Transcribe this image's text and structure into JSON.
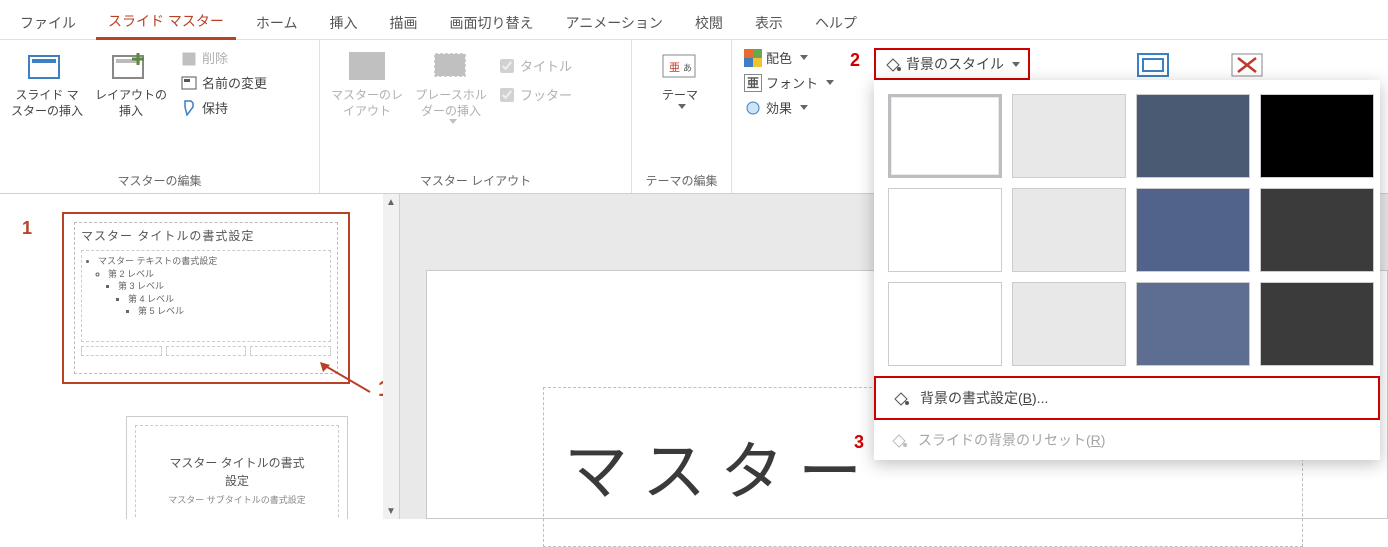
{
  "tabs": {
    "file": "ファイル",
    "slide_master": "スライド マスター",
    "home": "ホーム",
    "insert": "挿入",
    "draw": "描画",
    "transitions": "画面切り替え",
    "animations": "アニメーション",
    "review": "校閲",
    "view": "表示",
    "help": "ヘルプ"
  },
  "ribbon": {
    "group1": {
      "label": "マスターの編集",
      "insert_master": "スライド マスターの挿入",
      "insert_layout": "レイアウトの挿入",
      "delete": "削除",
      "rename": "名前の変更",
      "preserve": "保持"
    },
    "group2": {
      "label": "マスター レイアウト",
      "master_layout": "マスターのレイアウト",
      "insert_placeholder": "プレースホルダーの挿入",
      "title_chk": "タイトル",
      "footer_chk": "フッター"
    },
    "group3": {
      "label": "テーマの編集",
      "themes": "テーマ"
    },
    "group4": {
      "colors": "配色",
      "fonts": "フォント",
      "effects": "効果"
    },
    "bg_styles": "背景のスタイル"
  },
  "bg_panel": {
    "swatches": [
      {
        "bg": "#ffffff",
        "selected": true
      },
      {
        "bg": "#e8e8e8",
        "selected": false
      },
      {
        "bg": "#4a5a73",
        "selected": false
      },
      {
        "bg": "#000000",
        "selected": false
      },
      {
        "bg": "#ffffff",
        "selected": false
      },
      {
        "bg": "#e8e8e8",
        "selected": false
      },
      {
        "bg": "#51638a",
        "selected": false
      },
      {
        "bg": "#3b3b3b",
        "selected": false
      },
      {
        "bg": "#ffffff",
        "selected": false
      },
      {
        "bg": "#e8e8e8",
        "selected": false
      },
      {
        "bg": "#5d6e92",
        "selected": false
      },
      {
        "bg": "#3b3b3b",
        "selected": false
      }
    ],
    "format_bg": "背景の書式設定(",
    "format_bg_key": "B",
    "format_bg_suffix": ")...",
    "reset_bg": "スライドの背景のリセット(",
    "reset_bg_key": "R",
    "reset_bg_suffix": ")"
  },
  "thumb": {
    "master_title": "マスター タイトルの書式設定",
    "master_text": "マスター テキストの書式設定",
    "lvl2": "第 2 レベル",
    "lvl3": "第 3 レベル",
    "lvl4": "第 4 レベル",
    "lvl5": "第 5 レベル",
    "layout_title_l1": "マスター タイトルの書式",
    "layout_title_l2": "設定",
    "layout_sub": "マスター サブタイトルの書式設定"
  },
  "slide": {
    "title_text": "マスター"
  },
  "annot": {
    "one": "1",
    "two": "2",
    "three": "3"
  }
}
